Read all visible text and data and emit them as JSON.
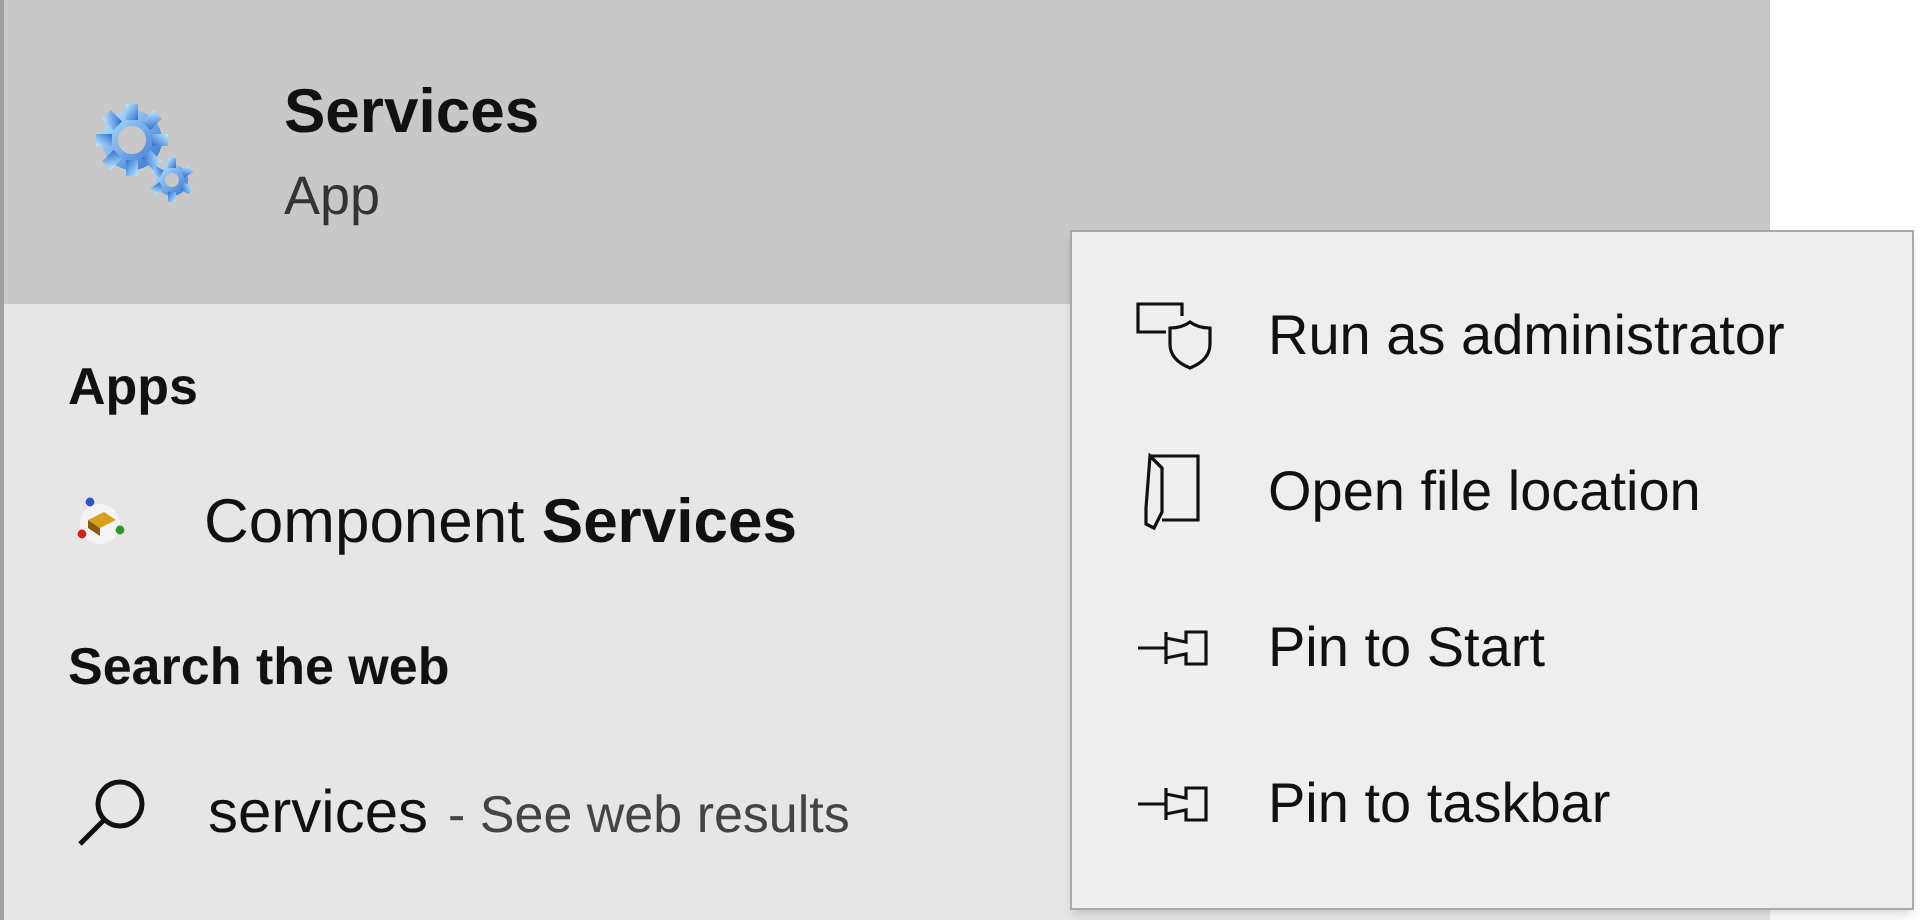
{
  "top_result": {
    "title": "Services",
    "subtitle": "App",
    "selected": true
  },
  "sections": [
    {
      "heading": "Apps",
      "items": [
        {
          "kind": "app",
          "text": "Component **Services**"
        }
      ]
    },
    {
      "heading": "Search the web",
      "items": [
        {
          "kind": "web",
          "query": "services",
          "suffix": "- See web results"
        }
      ]
    }
  ],
  "context_menu": {
    "items": [
      {
        "kind": "admin",
        "label": "Run as administrator"
      },
      {
        "kind": "folder",
        "label": "Open file location"
      },
      {
        "kind": "pin",
        "label": "Pin to Start"
      },
      {
        "kind": "pin",
        "label": "Pin to taskbar"
      }
    ]
  }
}
